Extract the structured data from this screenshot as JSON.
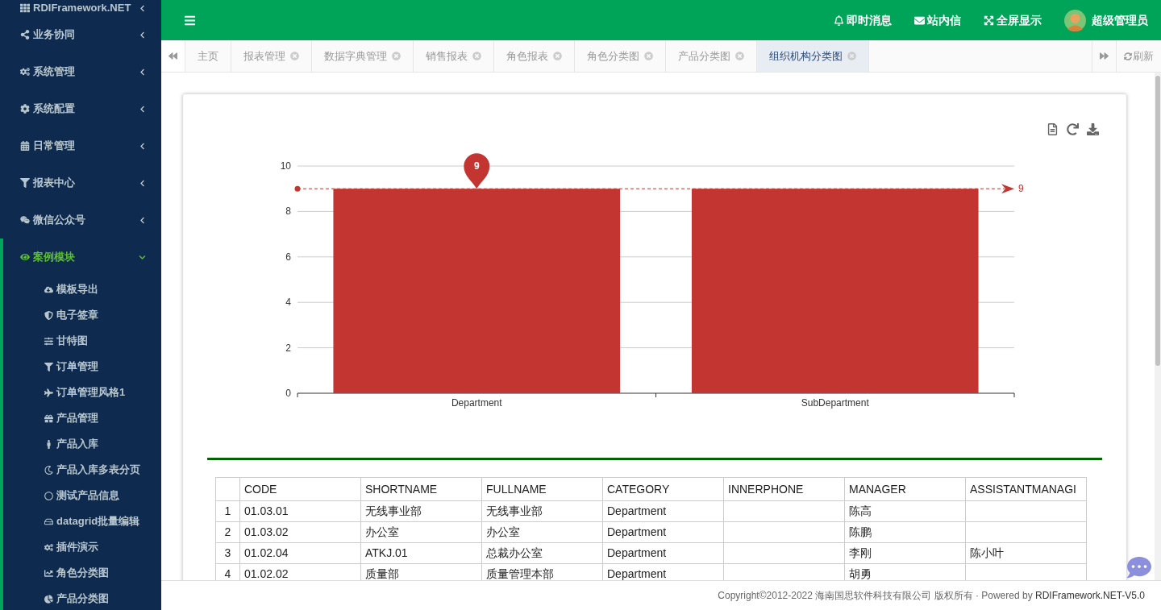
{
  "sidebar": {
    "items": [
      {
        "label": "RDIFramework.NET",
        "expanded": false
      },
      {
        "label": "业务协同",
        "expanded": false
      },
      {
        "label": "系统管理",
        "expanded": false
      },
      {
        "label": "系统配置",
        "expanded": false
      },
      {
        "label": "日常管理",
        "expanded": false
      },
      {
        "label": "报表中心",
        "expanded": false
      },
      {
        "label": "微信公众号",
        "expanded": false
      },
      {
        "label": "案例模块",
        "expanded": true,
        "children": [
          {
            "label": "模板导出"
          },
          {
            "label": "电子签章"
          },
          {
            "label": "甘特图"
          },
          {
            "label": "订单管理"
          },
          {
            "label": "订单管理风格1"
          },
          {
            "label": "产品管理"
          },
          {
            "label": "产品入库"
          },
          {
            "label": "产品入库多表分页"
          },
          {
            "label": "测试产品信息"
          },
          {
            "label": "datagrid批量编辑"
          },
          {
            "label": "插件演示"
          },
          {
            "label": "角色分类图"
          },
          {
            "label": "产品分类图"
          }
        ]
      }
    ]
  },
  "header": {
    "actions": [
      "即时消息",
      "站内信",
      "全屏显示"
    ],
    "user": "超级管理员"
  },
  "tabs": [
    {
      "label": "主页",
      "closable": false,
      "selected": false
    },
    {
      "label": "报表管理",
      "closable": true,
      "selected": false
    },
    {
      "label": "数据字典管理",
      "closable": true,
      "selected": false
    },
    {
      "label": "销售报表",
      "closable": true,
      "selected": false
    },
    {
      "label": "角色报表",
      "closable": true,
      "selected": false
    },
    {
      "label": "角色分类图",
      "closable": true,
      "selected": false
    },
    {
      "label": "产品分类图",
      "closable": true,
      "selected": false
    },
    {
      "label": "组织机构分类图",
      "closable": true,
      "selected": true
    }
  ],
  "refresh": "刷新",
  "chart": {
    "chart_data": {
      "type": "bar",
      "categories": [
        "Department",
        "SubDepartment"
      ],
      "values": [
        9,
        9
      ],
      "ylim": [
        0,
        10
      ],
      "yticks": [
        0,
        2,
        4,
        6,
        8,
        10
      ],
      "grid": true,
      "annotations": [
        {
          "x": "Department",
          "y": 9,
          "text": "9"
        }
      ],
      "ref_lines": [
        {
          "axis": "y",
          "value": 9,
          "label": "9"
        }
      ]
    }
  },
  "table": {
    "columns": [
      "",
      "CODE",
      "SHORTNAME",
      "FULLNAME",
      "CATEGORY",
      "INNERPHONE",
      "MANAGER",
      "ASSISTANTMANAGI"
    ],
    "rows": [
      [
        "1",
        "01.03.01",
        "无线事业部",
        "无线事业部",
        "Department",
        "",
        "陈高",
        ""
      ],
      [
        "2",
        "01.03.02",
        "办公室",
        "办公室",
        "Department",
        "",
        "陈鹏",
        ""
      ],
      [
        "3",
        "01.02.04",
        "ATKJ.01",
        "总裁办公室",
        "Department",
        "",
        "李刚",
        "陈小叶"
      ],
      [
        "4",
        "01.02.02",
        "质量部",
        "质量管理本部",
        "Department",
        "",
        "胡勇",
        ""
      ]
    ]
  },
  "footer": {
    "text": "Copyright©2012-2022 海南国思软件科技有限公司 版权所有 · Powered by ",
    "link": "RDIFramework.NET-V5.0"
  }
}
